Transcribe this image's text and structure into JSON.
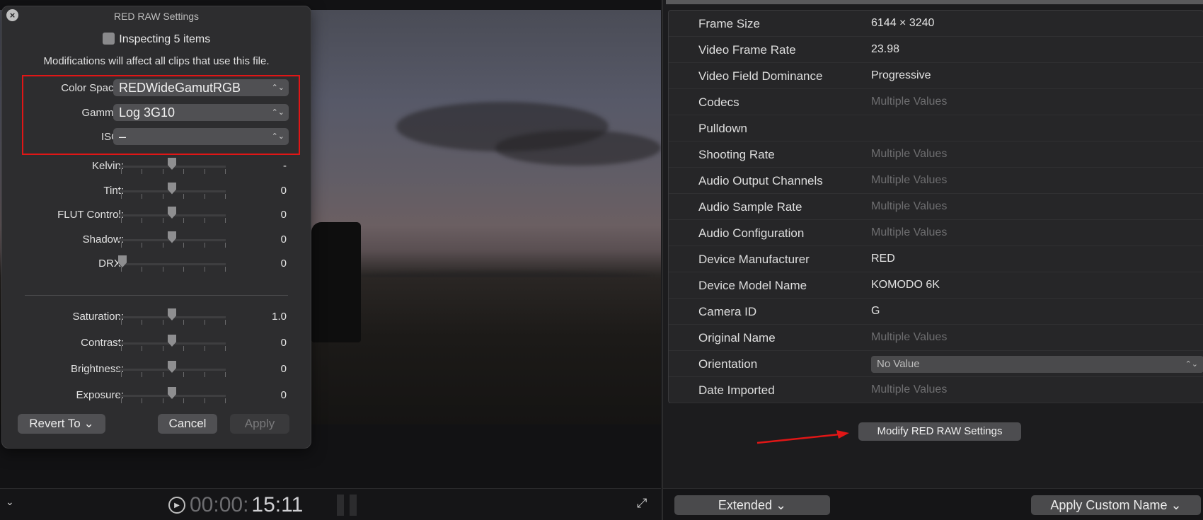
{
  "dialog": {
    "title": "RED RAW Settings",
    "close_icon": "close-icon",
    "inspecting_text": "Inspecting 5 items",
    "modification_note": "Modifications will affect all clips that use this file.",
    "color_space": {
      "label": "Color Space:",
      "value": "REDWideGamutRGB"
    },
    "gamma": {
      "label": "Gamma:",
      "value": "Log 3G10"
    },
    "iso": {
      "label": "ISO:",
      "value": "–"
    },
    "sliders": [
      {
        "label": "Kelvin:",
        "value": "-",
        "level": 0.5
      },
      {
        "label": "Tint:",
        "value": "0",
        "level": 0.5
      },
      {
        "label": "FLUT Control:",
        "value": "0",
        "level": 0.5
      },
      {
        "label": "Shadow:",
        "value": "0",
        "level": 0.5
      },
      {
        "label": "DRX:",
        "value": "0",
        "level": 0.0
      }
    ],
    "sliders2": [
      {
        "label": "Saturation:",
        "value": "1.0",
        "level": 0.5
      },
      {
        "label": "Contrast:",
        "value": "0",
        "level": 0.5
      },
      {
        "label": "Brightness:",
        "value": "0",
        "level": 0.5
      },
      {
        "label": "Exposure:",
        "value": "0",
        "level": 0.5
      }
    ],
    "revert_label": "Revert To",
    "cancel_label": "Cancel",
    "apply_label": "Apply",
    "highlight_color": "#e01616"
  },
  "viewer": {
    "timecode_dim": "00:00:",
    "timecode_bright": "15:11"
  },
  "inspector": {
    "rows": [
      {
        "key": "Frame Size",
        "value": "6144 × 3240",
        "placeholder": false
      },
      {
        "key": "Video Frame Rate",
        "value": "23.98",
        "placeholder": false
      },
      {
        "key": "Video Field Dominance",
        "value": "Progressive",
        "placeholder": false
      },
      {
        "key": "Codecs",
        "value": "Multiple Values",
        "placeholder": true
      },
      {
        "key": "Pulldown",
        "value": "",
        "placeholder": false
      },
      {
        "key": "Shooting Rate",
        "value": "Multiple Values",
        "placeholder": true
      },
      {
        "key": "Audio Output Channels",
        "value": "Multiple Values",
        "placeholder": true
      },
      {
        "key": "Audio Sample Rate",
        "value": "Multiple Values",
        "placeholder": true
      },
      {
        "key": "Audio Configuration",
        "value": "Multiple Values",
        "placeholder": true
      },
      {
        "key": "Device Manufacturer",
        "value": "RED",
        "placeholder": false
      },
      {
        "key": "Device Model Name",
        "value": "KOMODO 6K",
        "placeholder": false
      },
      {
        "key": "Camera ID",
        "value": "G",
        "placeholder": false
      },
      {
        "key": "Original Name",
        "value": "Multiple Values",
        "placeholder": true
      },
      {
        "key": "Orientation",
        "value": "No Value",
        "placeholder": false,
        "popup": true
      },
      {
        "key": "Date Imported",
        "value": "Multiple Values",
        "placeholder": true
      }
    ],
    "modify_button": "Modify RED RAW Settings",
    "footer_left": "Extended",
    "footer_right": "Apply Custom Name",
    "arrow_color": "#e01616"
  }
}
